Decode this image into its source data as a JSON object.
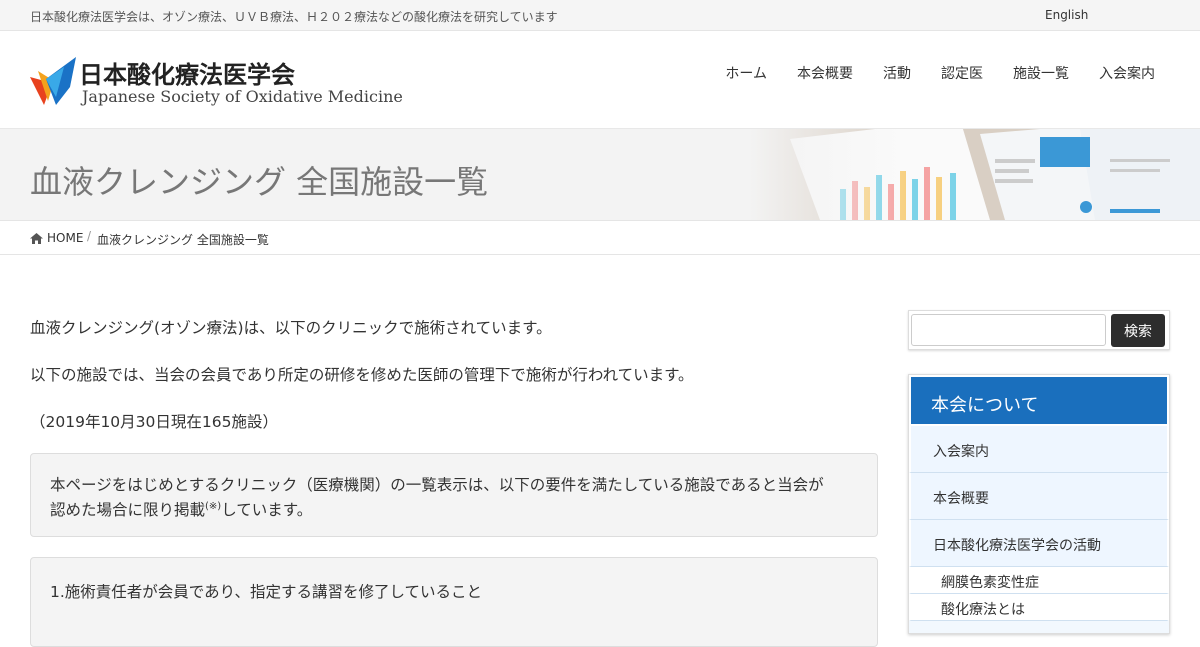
{
  "topbar": {
    "description": "日本酸化療法医学会は、オゾン療法、ＵＶＢ療法、Ｈ２０２療法などの酸化療法を研究しています",
    "lang_link": "English"
  },
  "header": {
    "logo_jp": "日本酸化療法医学会",
    "logo_en": "Japanese Society of Oxidative Medicine",
    "nav": [
      "ホーム",
      "本会概要",
      "活動",
      "認定医",
      "施設一覧",
      "入会案内"
    ]
  },
  "page": {
    "title": "血液クレンジング 全国施設一覧"
  },
  "breadcrumb": {
    "home": "HOME",
    "current": "血液クレンジング 全国施設一覧"
  },
  "main": {
    "p1": "血液クレンジング(オゾン療法)は、以下のクリニックで施術されています。",
    "p2": "以下の施設では、当会の会員であり所定の研修を修めた医師の管理下で施術が行われています。",
    "p3": "（2019年10月30日現在165施設）",
    "box1_line1": "本ページをはじめとするクリニック（医療機関）の一覧表示は、以下の要件を満たしている施設であると当会が",
    "box1_line2a": "認めた場合に限り掲載",
    "box1_sup": "(※)",
    "box1_line2b": "しています。",
    "box2_line1": "1.施術責任者が会員であり、指定する講習を修了していること"
  },
  "sidebar": {
    "search_button": "検索",
    "search_placeholder": "",
    "menu_title": "本会について",
    "items": [
      "入会案内",
      "本会概要",
      "日本酸化療法医学会の活動"
    ],
    "subitems": [
      "網膜色素変性症",
      "酸化療法とは"
    ]
  },
  "colors": {
    "accent": "#1a6fbd",
    "button_dark": "#2d2d2d"
  }
}
